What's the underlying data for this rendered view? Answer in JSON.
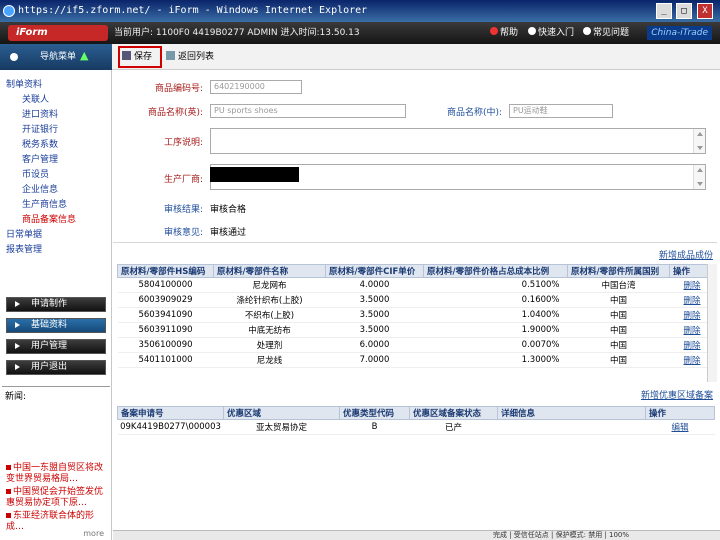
{
  "window": {
    "title": "https://if5.zform.net/ - iForm - Windows Internet Explorer",
    "min": "_",
    "max": "□",
    "close": "X"
  },
  "header": {
    "logo": "iForm",
    "user_info": "当前用户: 1100F0  4419B0277  ADMIN   进入时间:13.50.13",
    "help": "帮助",
    "quick_start": "快速入门",
    "faq": "常见问题",
    "brand": "China-iTrade"
  },
  "nav": {
    "title": "导航菜单",
    "tree_root": "制单资料",
    "tree_items": [
      "关联人",
      "进口资料",
      "开证银行",
      "税务系数",
      "客户管理",
      "币设员",
      "企业信息",
      "生产商信息",
      "商品备案信息"
    ],
    "tree_selected": 8,
    "tree_more": [
      "日常单据",
      "报表管理"
    ]
  },
  "menus": [
    "申请制作",
    "基础资料",
    "用户管理",
    "用户退出"
  ],
  "menus_active": 1,
  "news": {
    "title": "新闻:",
    "items": [
      "中国一东盟自贸区将改变世界贸易格局…",
      "中国贸促会开始签发优惠贸易协定项下原…",
      "东亚经济联合体的形成…"
    ],
    "more": "more"
  },
  "toolbar": {
    "save": "保存",
    "back": "返回列表"
  },
  "form": {
    "code_label": "商品编码号:",
    "code_value": "6402190000",
    "name_en_label": "商品名称(英):",
    "name_en_value": "PU sports shoes",
    "name_cn_label": "商品名称(中):",
    "name_cn_value": "PU运动鞋",
    "process_label": "工序说明:",
    "maker_label": "生产厂商:",
    "review_label": "审核结果:",
    "review_value": "审核合格",
    "opinion_label": "审核意见:",
    "opinion_value": "审核通过"
  },
  "materials": {
    "add_link": "新增成品成份",
    "headers": [
      "原材料/零部件HS编码",
      "原材料/零部件名称",
      "原材料/零部件CIF单价",
      "原材料/零部件价格占总成本比例",
      "原材料/零部件所属国别",
      "操作"
    ],
    "rows": [
      [
        "5804100000",
        "尼龙网布",
        "4.0000",
        "0.5100%",
        "中国台湾",
        "删除"
      ],
      [
        "6003909029",
        "涤纶针织布(上胶)",
        "3.5000",
        "0.1600%",
        "中国",
        "删除"
      ],
      [
        "5603941090",
        "不织布(上胶)",
        "3.5000",
        "1.0400%",
        "中国",
        "删除"
      ],
      [
        "5603911090",
        "中底无纺布",
        "3.5000",
        "1.9000%",
        "中国",
        "删除"
      ],
      [
        "3506100090",
        "处理剂",
        "6.0000",
        "0.0070%",
        "中国",
        "删除"
      ],
      [
        "5401101000",
        "尼龙线",
        "7.0000",
        "1.3000%",
        "中国",
        "删除"
      ]
    ]
  },
  "certs": {
    "add_link": "新增优惠区域备案",
    "headers": [
      "备案申请号",
      "优惠区域",
      "优惠类型代码",
      "优惠区域备案状态",
      "详细信息",
      "操作"
    ],
    "rows": [
      [
        "09K4419B0277\\000003",
        "亚太贸易协定",
        "B",
        "已产",
        "",
        "编辑"
      ]
    ]
  },
  "statusbar": "完成 | 受信任站点 | 保护模式: 禁用 | 100%"
}
